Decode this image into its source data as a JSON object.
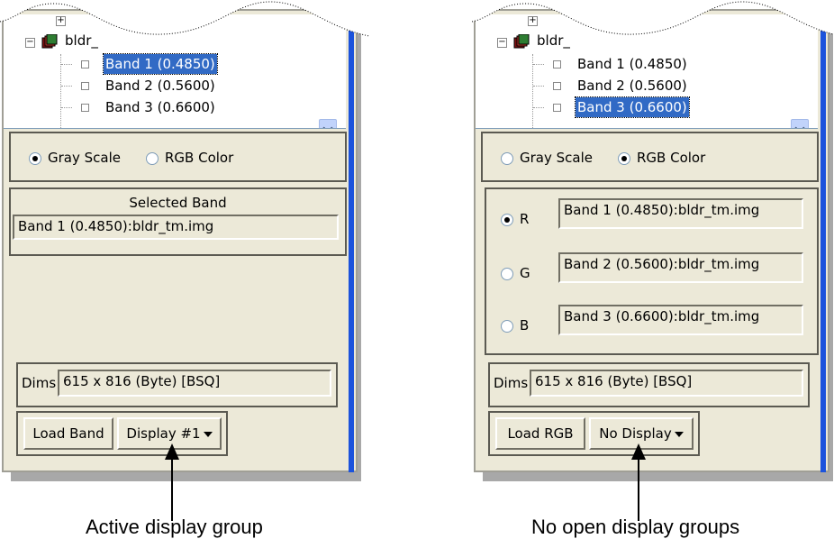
{
  "left": {
    "tree": {
      "file_name": "bldr_",
      "bands": [
        {
          "label": "Band 1 (0.4850)",
          "selected": true
        },
        {
          "label": "Band 2 (0.5600)",
          "selected": false
        },
        {
          "label": "Band 3 (0.6600)",
          "selected": false
        }
      ]
    },
    "mode": {
      "gray_label": "Gray Scale",
      "rgb_label": "RGB Color",
      "selected": "gray"
    },
    "selected_band": {
      "title": "Selected Band",
      "value": "Band 1 (0.4850):bldr_tm.img"
    },
    "dims": {
      "label": "Dims",
      "value": "615 x 816 (Byte) [BSQ]"
    },
    "buttons": {
      "load_label": "Load Band",
      "display_label": "Display #1"
    },
    "caption": "Active display group"
  },
  "right": {
    "tree": {
      "file_name": "bldr_",
      "bands": [
        {
          "label": "Band 1 (0.4850)",
          "selected": false
        },
        {
          "label": "Band 2 (0.5600)",
          "selected": false
        },
        {
          "label": "Band 3 (0.6600)",
          "selected": true
        }
      ]
    },
    "mode": {
      "gray_label": "Gray Scale",
      "rgb_label": "RGB Color",
      "selected": "rgb"
    },
    "rgb": [
      {
        "channel": "R",
        "value": "Band 1 (0.4850):bldr_tm.img",
        "selected": true
      },
      {
        "channel": "G",
        "value": "Band 2 (0.5600):bldr_tm.img",
        "selected": false
      },
      {
        "channel": "B",
        "value": "Band 3 (0.6600):bldr_tm.img",
        "selected": false
      }
    ],
    "dims": {
      "label": "Dims",
      "value": "615 x 816 (Byte) [BSQ]"
    },
    "buttons": {
      "load_label": "Load RGB",
      "display_label": "No Display"
    },
    "caption": "No open display groups"
  },
  "colors": {
    "selection": "#316ac5",
    "panel_bg": "#ece9d8",
    "blue_edge": "#1c53dc"
  }
}
